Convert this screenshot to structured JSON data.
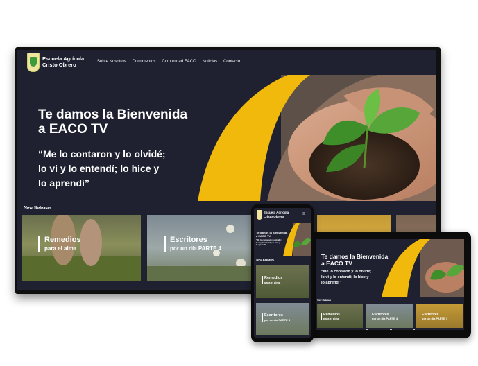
{
  "site": {
    "brand_line1": "Escuela Agrícola",
    "brand_line2": "Cristo Obrero",
    "nav": [
      "Sobre Nosotros",
      "Documentos",
      "Comunidad EACO",
      "Noticias",
      "Contacto"
    ]
  },
  "hero": {
    "title_line1": "Te damos la Bienvenida",
    "title_line2": "a EACO TV",
    "quote_line1": "“Me lo contaron y lo olvidé;",
    "quote_line2": "lo vi y lo entendí; lo hice y",
    "quote_line3": "lo aprendí”"
  },
  "section_title": "New Releases",
  "cards": [
    {
      "title": "Remedios",
      "subtitle": "para el alma"
    },
    {
      "title": "Escritores",
      "subtitle": "por un día PARTE 4"
    },
    {
      "title": "Escritores",
      "subtitle": "por un día PARTE 3"
    }
  ],
  "colors": {
    "background": "#1f2130",
    "accent_yellow": "#f2b90d",
    "text": "#ffffff"
  }
}
